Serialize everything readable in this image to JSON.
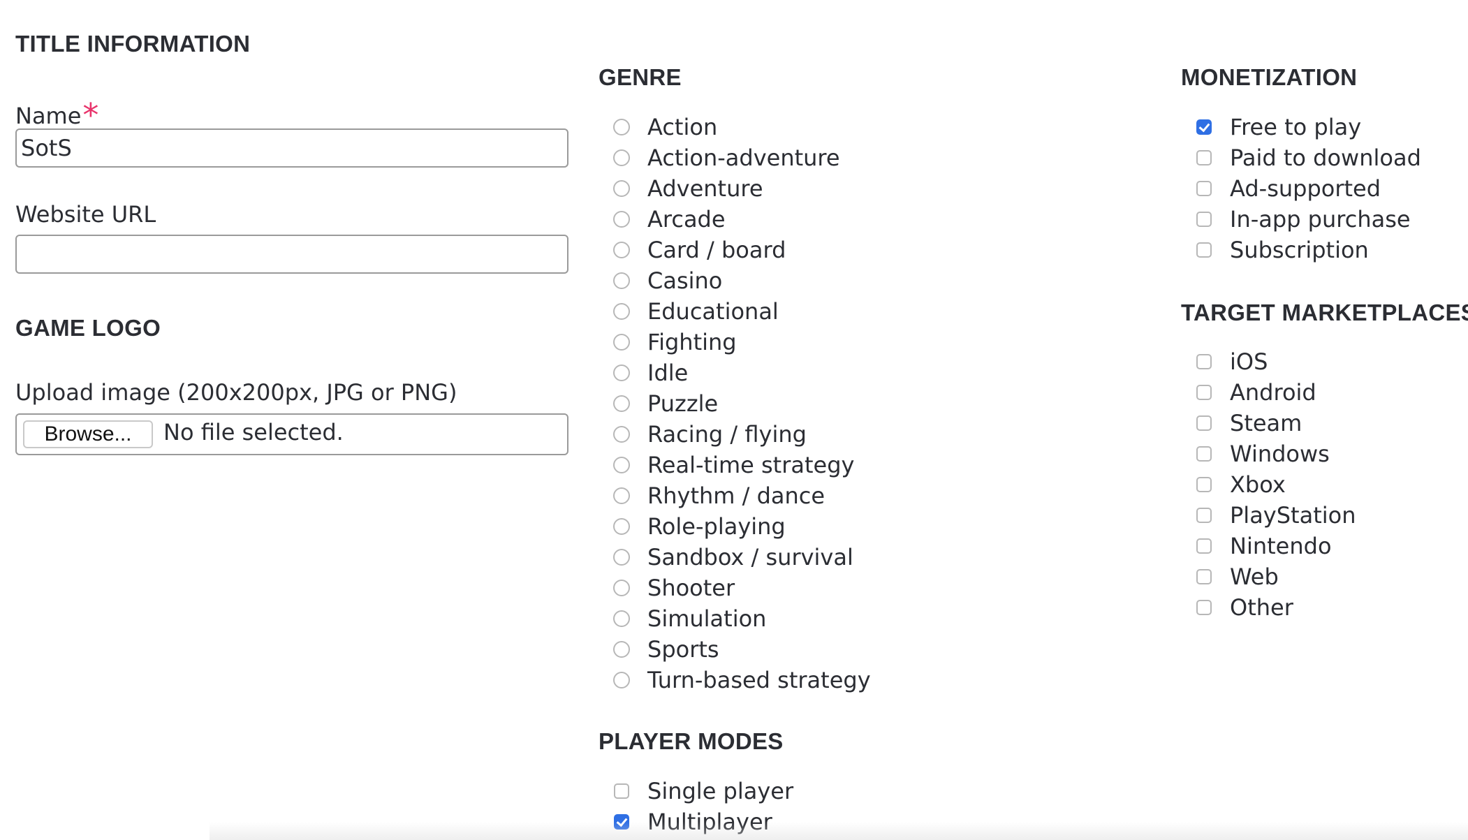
{
  "title_information": {
    "heading": "TITLE INFORMATION",
    "name_label": "Name",
    "required_marker": "*",
    "name_value": "SotS",
    "website_label": "Website URL",
    "website_value": ""
  },
  "game_logo": {
    "heading": "GAME LOGO",
    "upload_label": "Upload image (200x200px, JPG or PNG)",
    "browse_label": "Browse...",
    "file_status": "No file selected."
  },
  "genre": {
    "heading": "GENRE",
    "options": [
      {
        "label": "Action",
        "selected": false
      },
      {
        "label": "Action-adventure",
        "selected": false
      },
      {
        "label": "Adventure",
        "selected": false
      },
      {
        "label": "Arcade",
        "selected": false
      },
      {
        "label": "Card / board",
        "selected": false
      },
      {
        "label": "Casino",
        "selected": false
      },
      {
        "label": "Educational",
        "selected": false
      },
      {
        "label": "Fighting",
        "selected": false
      },
      {
        "label": "Idle",
        "selected": false
      },
      {
        "label": "Puzzle",
        "selected": false
      },
      {
        "label": "Racing / flying",
        "selected": false
      },
      {
        "label": "Real-time strategy",
        "selected": false
      },
      {
        "label": "Rhythm / dance",
        "selected": false
      },
      {
        "label": "Role-playing",
        "selected": false
      },
      {
        "label": "Sandbox / survival",
        "selected": false
      },
      {
        "label": "Shooter",
        "selected": false
      },
      {
        "label": "Simulation",
        "selected": false
      },
      {
        "label": "Sports",
        "selected": false
      },
      {
        "label": "Turn-based strategy",
        "selected": false
      }
    ]
  },
  "player_modes": {
    "heading": "PLAYER MODES",
    "options": [
      {
        "label": "Single player",
        "checked": false
      },
      {
        "label": "Multiplayer",
        "checked": true
      }
    ]
  },
  "monetization": {
    "heading": "MONETIZATION",
    "options": [
      {
        "label": "Free to play",
        "checked": true
      },
      {
        "label": "Paid to download",
        "checked": false
      },
      {
        "label": "Ad-supported",
        "checked": false
      },
      {
        "label": "In-app purchase",
        "checked": false
      },
      {
        "label": "Subscription",
        "checked": false
      }
    ]
  },
  "target_marketplaces": {
    "heading": "TARGET MARKETPLACES",
    "options": [
      {
        "label": "iOS",
        "checked": false
      },
      {
        "label": "Android",
        "checked": false
      },
      {
        "label": "Steam",
        "checked": false
      },
      {
        "label": "Windows",
        "checked": false
      },
      {
        "label": "Xbox",
        "checked": false
      },
      {
        "label": "PlayStation",
        "checked": false
      },
      {
        "label": "Nintendo",
        "checked": false
      },
      {
        "label": "Web",
        "checked": false
      },
      {
        "label": "Other",
        "checked": false
      }
    ]
  },
  "colors": {
    "text": "#2b2d33",
    "required": "#e8336b",
    "checked": "#2f6fe4",
    "border": "#9a9a9a"
  }
}
